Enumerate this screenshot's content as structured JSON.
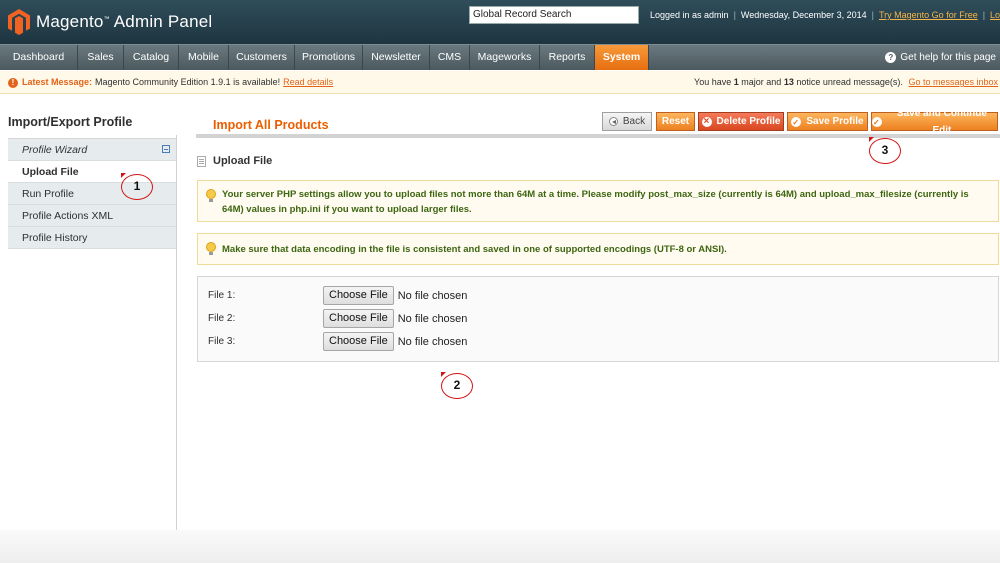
{
  "header": {
    "logo_brand": "Magento",
    "logo_rest": "Admin Panel",
    "search_value": "Global Record Search",
    "logged_in": "Logged in as admin",
    "date": "Wednesday, December 3, 2014",
    "try_link": "Try Magento Go for Free",
    "logout_link": "Log Out"
  },
  "nav": {
    "items": [
      "Dashboard",
      "Sales",
      "Catalog",
      "Mobile",
      "Customers",
      "Promotions",
      "Newsletter",
      "CMS",
      "Mageworks",
      "Reports",
      "System"
    ],
    "active": "System",
    "help": "Get help for this page"
  },
  "message": {
    "label": "Latest Message:",
    "text": "Magento Community Edition 1.9.1 is available!",
    "read_link": "Read details",
    "right_text_1": "You have",
    "major_count": "1",
    "right_text_2": "major and",
    "notice_count": "13",
    "right_text_3": "notice unread message(s).",
    "inbox_link": "Go to messages inbox"
  },
  "sidebar": {
    "title": "Import/Export Profile",
    "items": [
      {
        "label": "Profile Wizard"
      },
      {
        "label": "Upload File"
      },
      {
        "label": "Run Profile"
      },
      {
        "label": "Profile Actions XML"
      },
      {
        "label": "Profile History"
      }
    ]
  },
  "main": {
    "title": "Import All Products",
    "buttons": {
      "back": "Back",
      "reset": "Reset",
      "delete": "Delete Profile",
      "save": "Save Profile",
      "save_continue": "Save and Continue Edit"
    },
    "section_title": "Upload File",
    "notice_1": "Your server PHP settings allow you to upload files not more than 64M at a time. Please modify post_max_size (currently is 64M) and upload_max_filesize (currently is 64M) values in php.ini if you want to upload larger files.",
    "notice_2": "Make sure that data encoding in the file is consistent and saved in one of supported encodings (UTF-8 or ANSI).",
    "files": [
      {
        "label": "File 1:",
        "button": "Choose File",
        "status": "No file chosen"
      },
      {
        "label": "File 2:",
        "button": "Choose File",
        "status": "No file chosen"
      },
      {
        "label": "File 3:",
        "button": "Choose File",
        "status": "No file chosen"
      }
    ]
  },
  "annotations": [
    "1",
    "2",
    "3"
  ],
  "colors": {
    "accent_orange": "#eb5e00",
    "header_bg": "#2f4d5a",
    "notice_text": "#3d6611",
    "annotation_red": "#d21414"
  }
}
